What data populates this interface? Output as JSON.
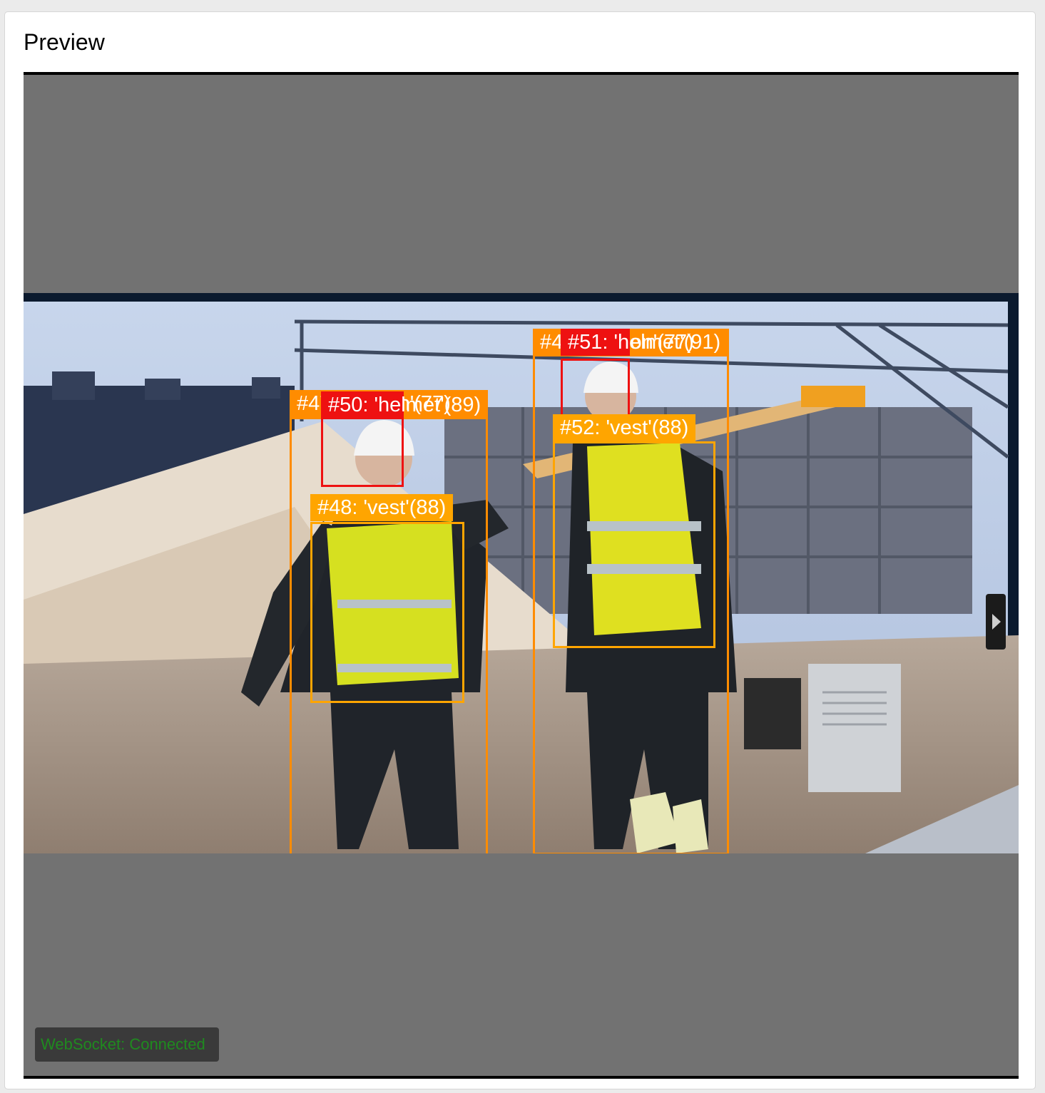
{
  "panel": {
    "title": "Preview"
  },
  "detections": [
    {
      "id": "#47",
      "label": "#47: 'person'(77)",
      "kind": "person"
    },
    {
      "id": "#50",
      "label": "#50: 'helmet'(89)",
      "kind": "helmet"
    },
    {
      "id": "#48",
      "label": "#48: 'vest'(88)",
      "kind": "vest"
    },
    {
      "id": "#49",
      "label": "#49: 'person'(77)",
      "kind": "person"
    },
    {
      "id": "#51",
      "label": "#51: 'helmet'(91)",
      "kind": "helmet"
    },
    {
      "id": "#52",
      "label": "#52: 'vest'(88)",
      "kind": "vest"
    }
  ],
  "colors": {
    "person": "#ff8c00",
    "helmet": "#ee1111",
    "vest": "#ffa500"
  },
  "status": {
    "text": "WebSocket: Connected",
    "color": "#1f8a1f"
  },
  "icons": {
    "next": "chevron-right-icon"
  }
}
